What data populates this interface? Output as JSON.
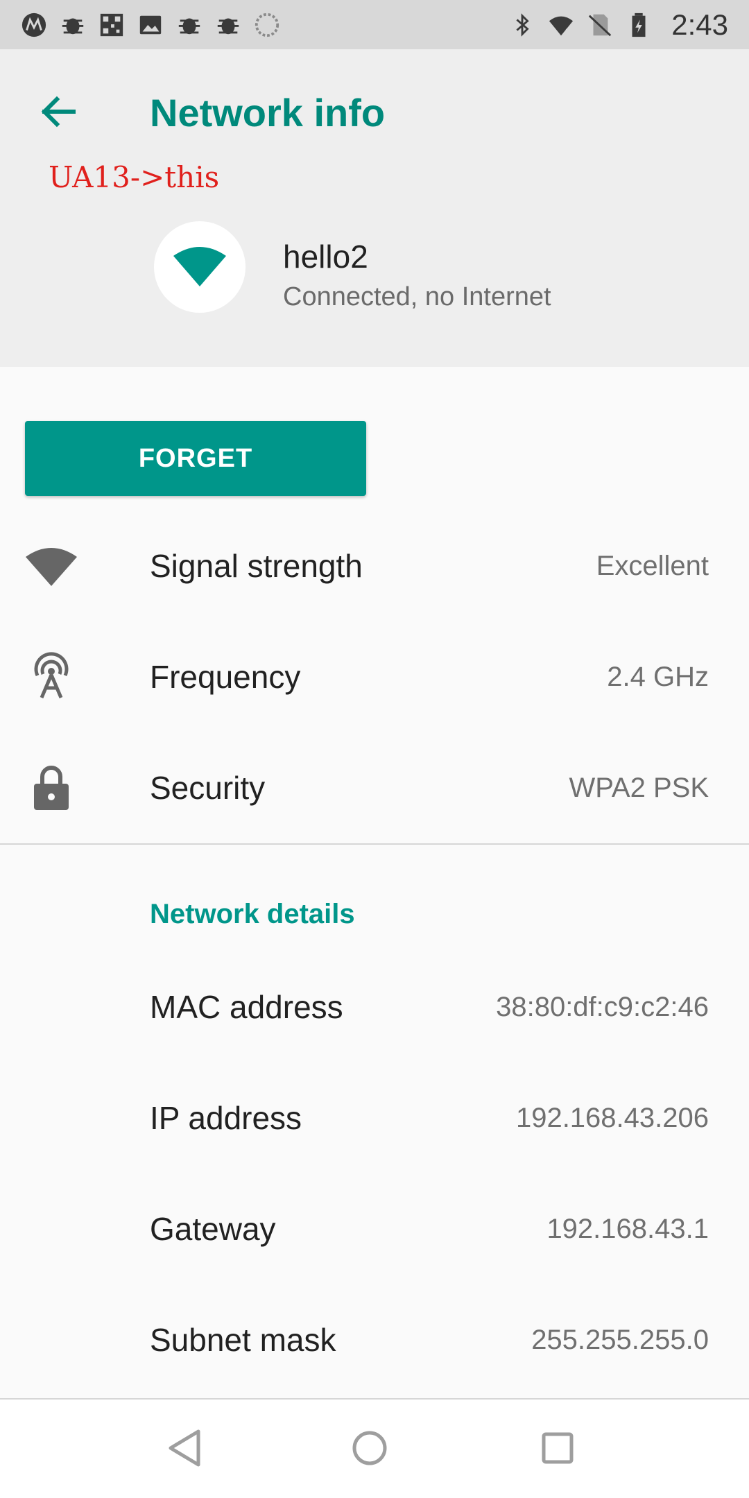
{
  "status_bar": {
    "time": "2:43",
    "left_icons": [
      "motorola-icon",
      "bug-icon",
      "qr-icon",
      "image-icon",
      "bug-icon",
      "bug-icon",
      "sync-icon"
    ],
    "right_icons": [
      "bluetooth-icon",
      "wifi-no-internet-icon",
      "no-sim-icon",
      "battery-icon"
    ]
  },
  "header": {
    "title": "Network info",
    "back_icon": "arrow-left-icon",
    "annotation": "UA13->this",
    "network_name": "hello2",
    "network_status": "Connected, no Internet",
    "network_icon": "wifi-icon"
  },
  "forget_button": {
    "label": "FORGET"
  },
  "info_rows": [
    {
      "icon": "wifi-signal-icon",
      "label": "Signal strength",
      "value": "Excellent"
    },
    {
      "icon": "antenna-icon",
      "label": "Frequency",
      "value": "2.4 GHz"
    },
    {
      "icon": "lock-icon",
      "label": "Security",
      "value": "WPA2 PSK"
    }
  ],
  "network_details": {
    "title": "Network details",
    "rows": [
      {
        "label": "MAC address",
        "value": "38:80:df:c9:c2:46"
      },
      {
        "label": "IP address",
        "value": "192.168.43.206"
      },
      {
        "label": "Gateway",
        "value": "192.168.43.1"
      },
      {
        "label": "Subnet mask",
        "value": "255.255.255.0"
      }
    ]
  },
  "nav_bar": {
    "back": "nav-back-icon",
    "home": "nav-home-icon",
    "recents": "nav-recents-icon"
  },
  "colors": {
    "accent": "#00968a",
    "annotation": "#e0201c"
  }
}
